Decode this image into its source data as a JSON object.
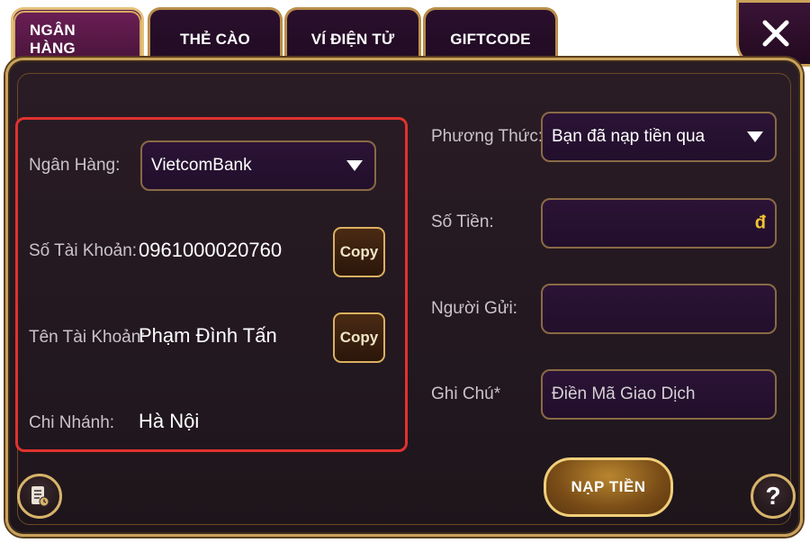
{
  "tabs": [
    {
      "label": "NGÂN HÀNG",
      "active": true
    },
    {
      "label": "THẺ CÀO",
      "active": false
    },
    {
      "label": "VÍ ĐIỆN TỬ",
      "active": false
    },
    {
      "label": "GIFTCODE",
      "active": false
    }
  ],
  "bank": {
    "bank_label": "Ngân Hàng:",
    "bank_selected": "VietcomBank",
    "account_number_label": "Số Tài Khoản:",
    "account_number": "0961000020760",
    "account_name_label": "Tên Tài Khoản:",
    "account_name": "Phạm Đình Tấn",
    "branch_label": "Chi Nhánh:",
    "branch": "Hà Nội",
    "copy_label": "Copy"
  },
  "form": {
    "method_label": "Phương Thức:",
    "method_selected": "Bạn đã nạp tiền qua",
    "amount_label": "Số Tiền:",
    "amount_value": "",
    "currency_symbol": "đ",
    "sender_label": "Người Gửi:",
    "sender_value": "",
    "note_label": "Ghi Chú*",
    "note_placeholder": "Điền Mã Giao Dịch",
    "submit_label": "NẠP TIỀN"
  },
  "buttons": {
    "close_icon": "close-icon",
    "history_icon": "history-icon",
    "help_icon": "help-icon",
    "help_glyph": "?"
  },
  "colors": {
    "gold_border": "#c9a15a",
    "highlight_border": "#e0322f",
    "accent_yellow": "#f2c532",
    "panel_bg": "#231820"
  }
}
